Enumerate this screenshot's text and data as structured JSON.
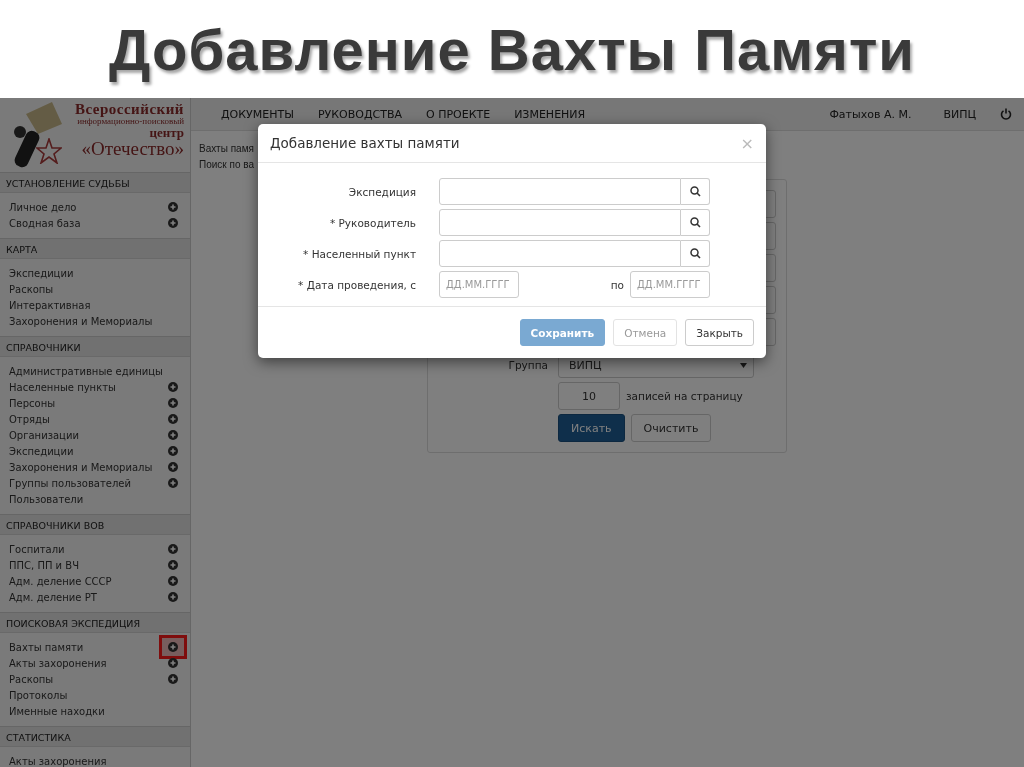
{
  "slide_title": "Добавление Вахты Памяти",
  "logo": {
    "lines": [
      "Всероссийский",
      "информационно-поисковый",
      "центр",
      "«Отечество»"
    ]
  },
  "nav": {
    "items": [
      "ДОКУМЕНТЫ",
      "РУКОВОДСТВА",
      "О ПРОЕКТЕ",
      "ИЗМЕНЕНИЯ"
    ],
    "user": "Фатыхов А. М.",
    "org": "ВИПЦ"
  },
  "sidebar": [
    {
      "title": "УСТАНОВЛЕНИЕ СУДЬБЫ",
      "items": [
        {
          "label": "Личное дело",
          "add": true,
          "highlighted": false
        },
        {
          "label": "Сводная база",
          "add": true,
          "highlighted": false
        }
      ]
    },
    {
      "title": "КАРТА",
      "items": [
        {
          "label": "Экспедиции",
          "add": false,
          "highlighted": false
        },
        {
          "label": "Раскопы",
          "add": false,
          "highlighted": false
        },
        {
          "label": "Интерактивная",
          "add": false,
          "highlighted": false
        },
        {
          "label": "Захоронения и Мемориалы",
          "add": false,
          "highlighted": false
        }
      ]
    },
    {
      "title": "СПРАВОЧНИКИ",
      "items": [
        {
          "label": "Административные единицы",
          "add": false,
          "highlighted": false
        },
        {
          "label": "Населенные пункты",
          "add": true,
          "highlighted": false
        },
        {
          "label": "Персоны",
          "add": true,
          "highlighted": false
        },
        {
          "label": "Отряды",
          "add": true,
          "highlighted": false
        },
        {
          "label": "Организации",
          "add": true,
          "highlighted": false
        },
        {
          "label": "Экспедиции",
          "add": true,
          "highlighted": false
        },
        {
          "label": "Захоронения и Мемориалы",
          "add": true,
          "highlighted": false
        },
        {
          "label": "Группы пользователей",
          "add": true,
          "highlighted": false
        },
        {
          "label": "Пользователи",
          "add": false,
          "highlighted": false
        }
      ]
    },
    {
      "title": "СПРАВОЧНИКИ ВОВ",
      "items": [
        {
          "label": "Госпитали",
          "add": true,
          "highlighted": false
        },
        {
          "label": "ППС, ПП и ВЧ",
          "add": true,
          "highlighted": false
        },
        {
          "label": "Адм. деление СССР",
          "add": true,
          "highlighted": false
        },
        {
          "label": "Адм. деление РТ",
          "add": true,
          "highlighted": false
        }
      ]
    },
    {
      "title": "ПОИСКОВАЯ ЭКСПЕДИЦИЯ",
      "items": [
        {
          "label": "Вахты памяти",
          "add": true,
          "highlighted": true
        },
        {
          "label": "Акты захоронения",
          "add": true,
          "highlighted": false
        },
        {
          "label": "Раскопы",
          "add": true,
          "highlighted": false
        },
        {
          "label": "Протоколы",
          "add": false,
          "highlighted": false
        },
        {
          "label": "Именные находки",
          "add": false,
          "highlighted": false
        }
      ]
    },
    {
      "title": "СТАТИСТИКА",
      "items": [
        {
          "label": "Акты захоронения",
          "add": false,
          "highlighted": false
        }
      ]
    }
  ],
  "page": {
    "breadcrumb": "Вахты памя",
    "subtitle": "Поиск по ва"
  },
  "search_panel": {
    "group_label": "Группа",
    "group_value": "ВИПЦ",
    "page_size": "10",
    "page_size_label": "записей на страницу",
    "buttons": [
      "Искать",
      "Очистить"
    ]
  },
  "dialog": {
    "title": "Добавление вахты памяти",
    "close": "×",
    "fields": [
      {
        "kind": "lookup",
        "label": "Экспедиция"
      },
      {
        "kind": "lookup",
        "label": "* Руководитель"
      },
      {
        "kind": "lookup",
        "label": "* Населенный пункт"
      },
      {
        "kind": "daterange",
        "label": "* Дата проведения, с",
        "placeholder_from": "ДД.ММ.ГГГГ",
        "separator": "по",
        "placeholder_to": "ДД.ММ.ГГГГ"
      }
    ],
    "buttons": [
      {
        "label": "Сохранить",
        "kind": "primary",
        "disabled": true
      },
      {
        "label": "Отмена",
        "kind": "default",
        "disabled": true
      },
      {
        "label": "Закрыть",
        "kind": "default",
        "disabled": false
      }
    ]
  }
}
